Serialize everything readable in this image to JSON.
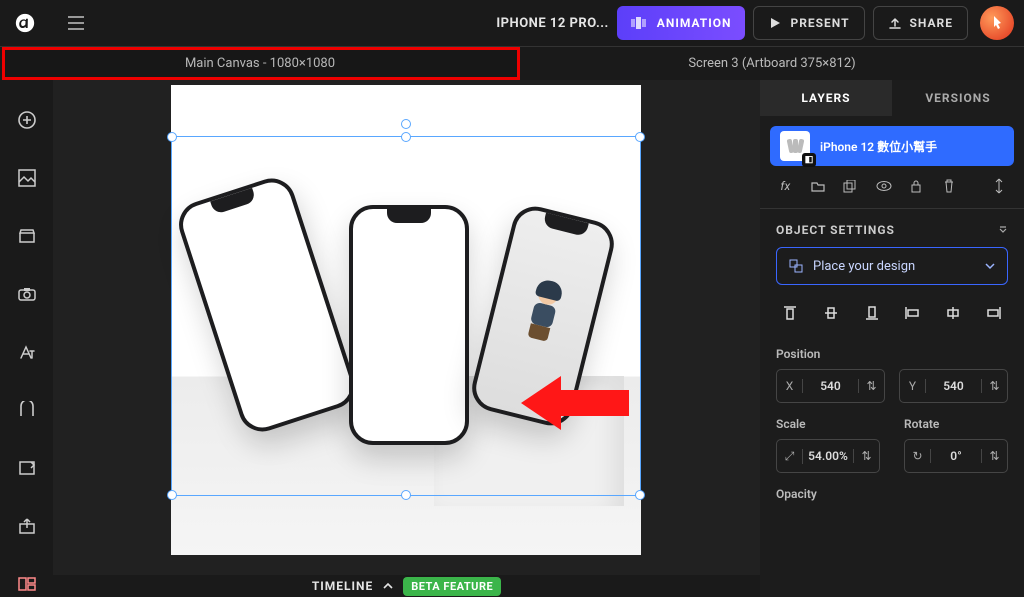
{
  "header": {
    "project_title": "IPHONE 12 PRO...",
    "animation_label": "ANIMATION",
    "present_label": "PRESENT",
    "share_label": "SHARE"
  },
  "tabs": {
    "main_canvas": "Main Canvas - 1080×1080",
    "screen": "Screen 3 (Artboard 375×812)"
  },
  "timeline": {
    "label": "TIMELINE",
    "beta": "BETA FEATURE"
  },
  "right_panel": {
    "tabs": {
      "layers": "LAYERS",
      "versions": "VERSIONS"
    },
    "layer_name": "iPhone 12 數位小幫手",
    "object_settings": "OBJECT SETTINGS",
    "place_design": "Place your design",
    "position_label": "Position",
    "pos_x_tag": "X",
    "pos_x_val": "540",
    "pos_y_tag": "Y",
    "pos_y_val": "540",
    "scale_label": "Scale",
    "scale_val": "54.00%",
    "rotate_label": "Rotate",
    "rotate_val": "0°",
    "opacity_label": "Opacity"
  }
}
